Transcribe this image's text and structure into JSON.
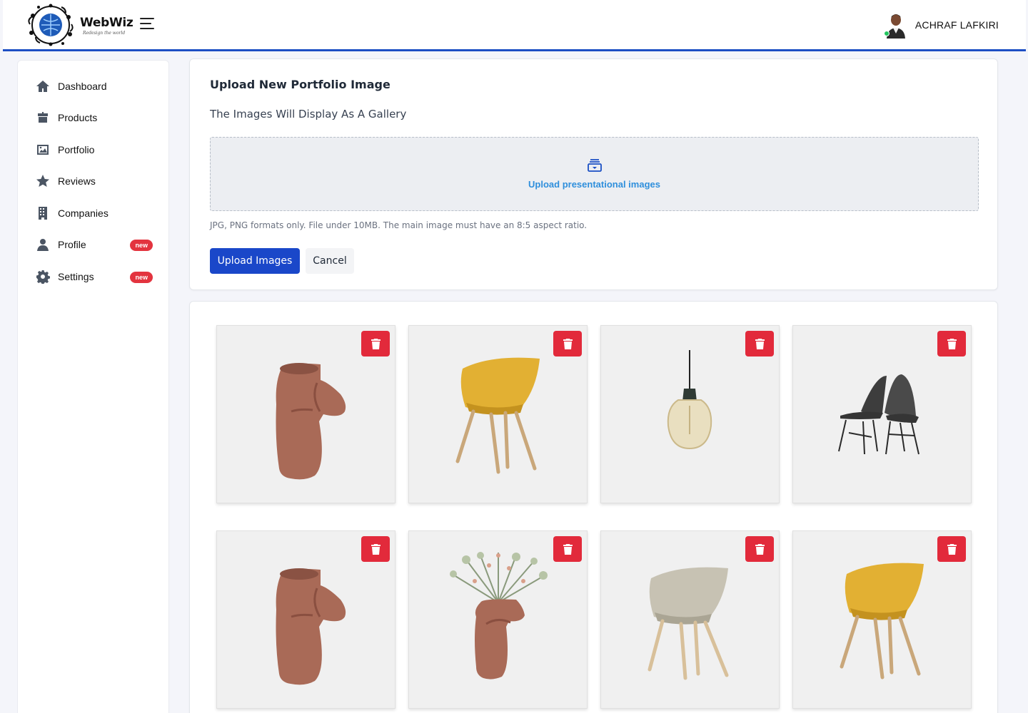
{
  "brand": {
    "name": "WebWiz",
    "tagline": "Redesign the world"
  },
  "user": {
    "name": "ACHRAF LAFKIRI"
  },
  "sidebar": {
    "items": [
      {
        "label": "Dashboard",
        "icon": "home-icon"
      },
      {
        "label": "Products",
        "icon": "box-icon"
      },
      {
        "label": "Portfolio",
        "icon": "image-icon"
      },
      {
        "label": "Reviews",
        "icon": "star-icon"
      },
      {
        "label": "Companies",
        "icon": "building-icon"
      },
      {
        "label": "Profile",
        "icon": "user-icon",
        "badge": "new"
      },
      {
        "label": "Settings",
        "icon": "gear-icon",
        "badge": "new"
      }
    ]
  },
  "upload": {
    "title": "Upload New Portfolio Image",
    "subtitle": "The Images Will Display As A Gallery",
    "dropzone_label": "Upload presentational images",
    "help_text": "JPG, PNG formats only. File under 10MB. The main image must have an 8:5 aspect ratio.",
    "upload_button": "Upload Images",
    "cancel_button": "Cancel"
  },
  "gallery": {
    "images": [
      {
        "subject": "terracotta-vase"
      },
      {
        "subject": "yellow-chair"
      },
      {
        "subject": "pendant-lamp"
      },
      {
        "subject": "black-chairs"
      },
      {
        "subject": "terracotta-vase"
      },
      {
        "subject": "vase-with-flowers"
      },
      {
        "subject": "beige-chair"
      },
      {
        "subject": "yellow-chair"
      }
    ]
  },
  "colors": {
    "accent": "#1d4fc4",
    "primary_button": "#1a47c9",
    "delete": "#e22a3b",
    "badge": "#e3343f",
    "link": "#2f8fdc"
  }
}
